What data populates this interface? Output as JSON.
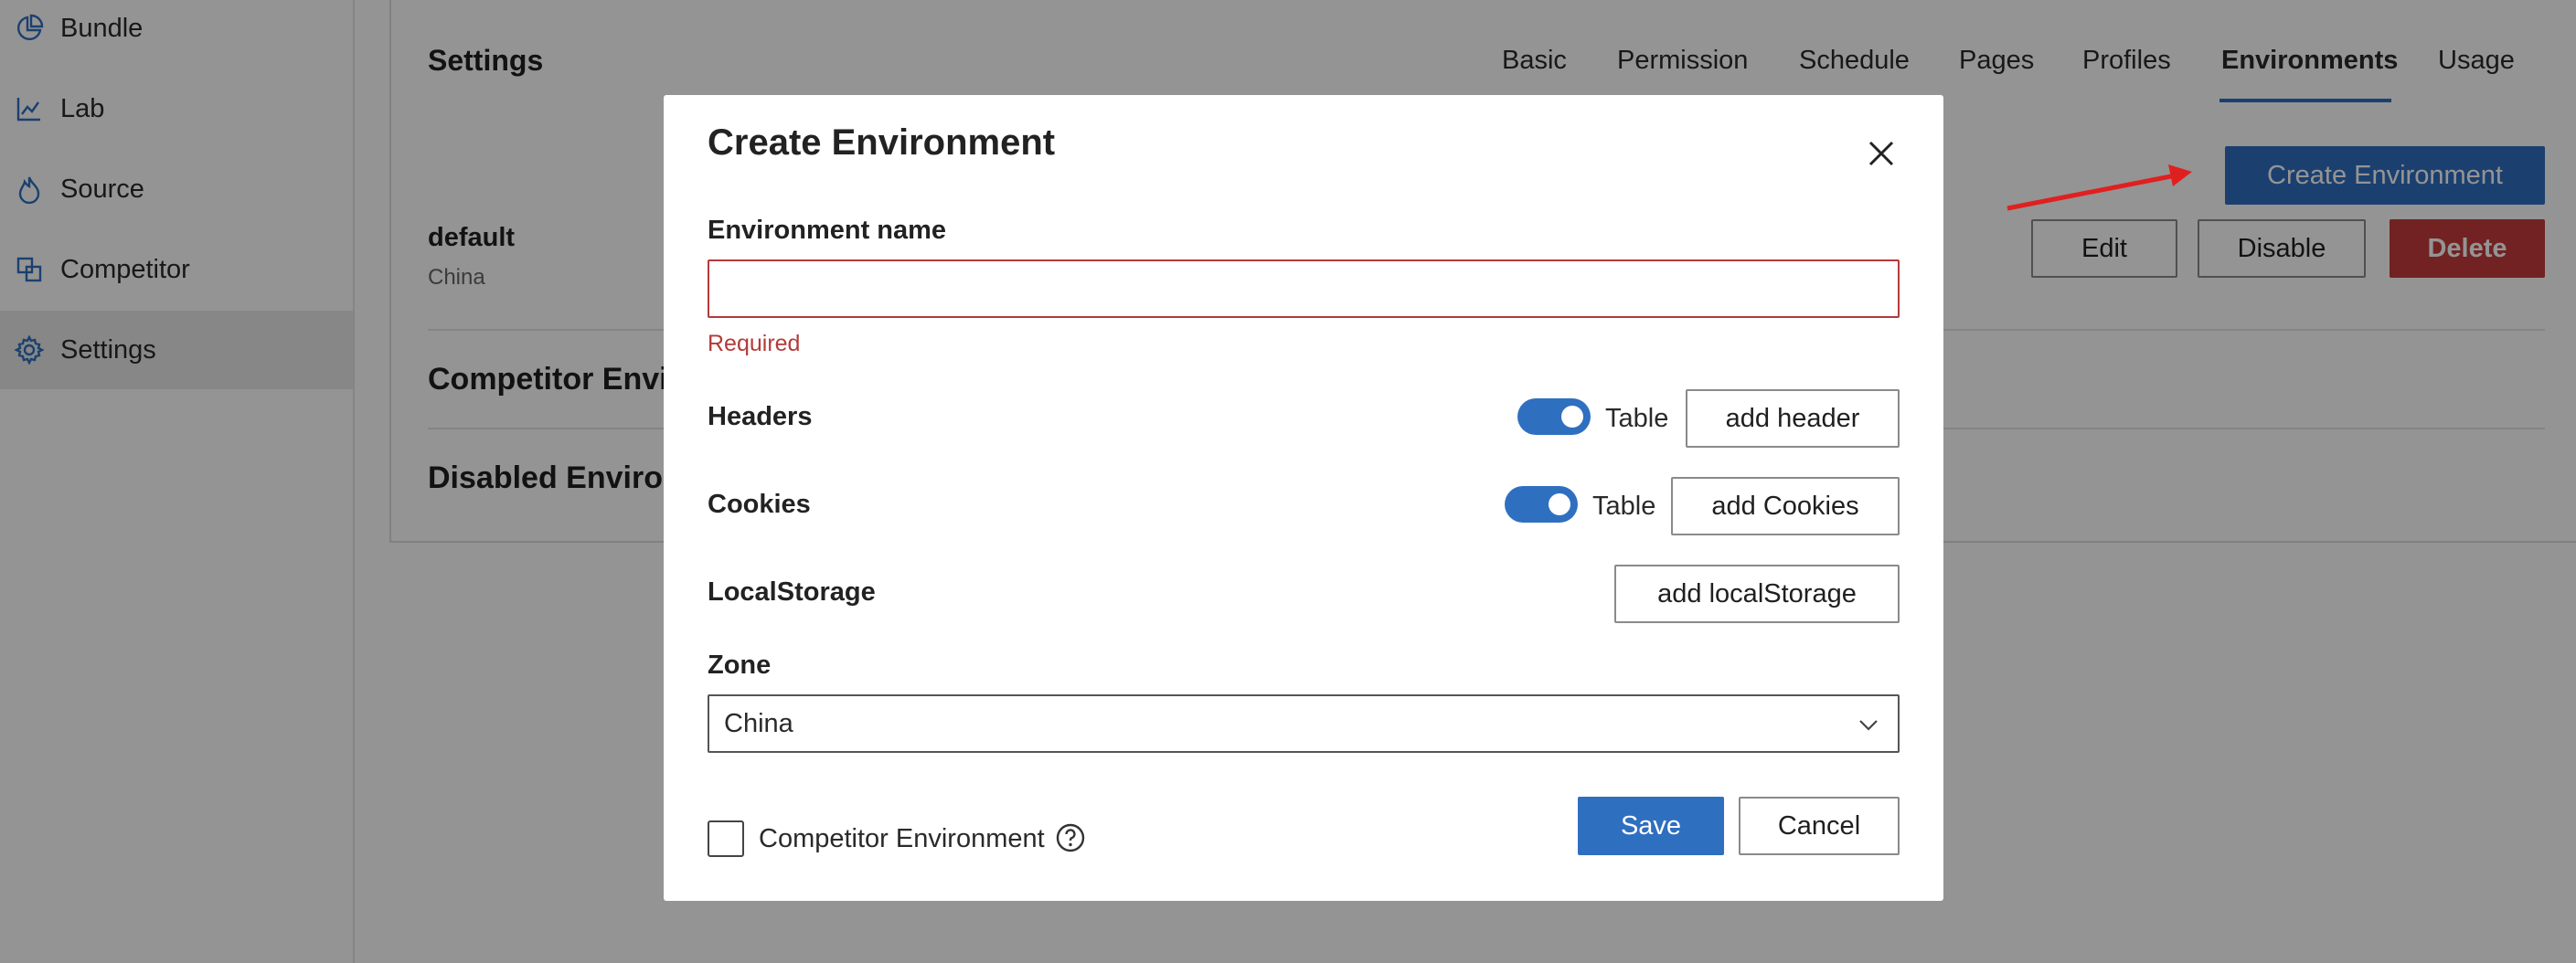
{
  "sidebar": {
    "items": [
      {
        "label": "Bundle",
        "icon": "pie-chart-icon"
      },
      {
        "label": "Lab",
        "icon": "line-chart-icon"
      },
      {
        "label": "Source",
        "icon": "flame-icon"
      },
      {
        "label": "Competitor",
        "icon": "compare-icon"
      },
      {
        "label": "Settings",
        "icon": "gear-icon",
        "active": true
      }
    ]
  },
  "main": {
    "title": "Settings",
    "tabs": [
      "Basic",
      "Permission",
      "Schedule",
      "Pages",
      "Profiles",
      "Environments",
      "Usage"
    ],
    "active_tab": "Environments",
    "create_button": "Create Environment",
    "environment": {
      "name": "default",
      "zone": "China",
      "edit_label": "Edit",
      "disable_label": "Disable",
      "delete_label": "Delete"
    },
    "sections": [
      "Competitor Environments",
      "Disabled Environments"
    ]
  },
  "modal": {
    "title": "Create Environment",
    "name_label": "Environment name",
    "name_value": "",
    "required_text": "Required",
    "headers_label": "Headers",
    "headers_toggle_label": "Table",
    "add_header_label": "add header",
    "cookies_label": "Cookies",
    "cookies_toggle_label": "Table",
    "add_cookies_label": "add Cookies",
    "localstorage_label": "LocalStorage",
    "add_localstorage_label": "add localStorage",
    "zone_label": "Zone",
    "zone_value": "China",
    "competitor_label": "Competitor Environment",
    "competitor_checked": false,
    "save_label": "Save",
    "cancel_label": "Cancel"
  },
  "colors": {
    "accent": "#2f6fc0",
    "danger": "#c43b3b",
    "annotation_arrow": "#e02020",
    "error": "#b43a3a"
  }
}
